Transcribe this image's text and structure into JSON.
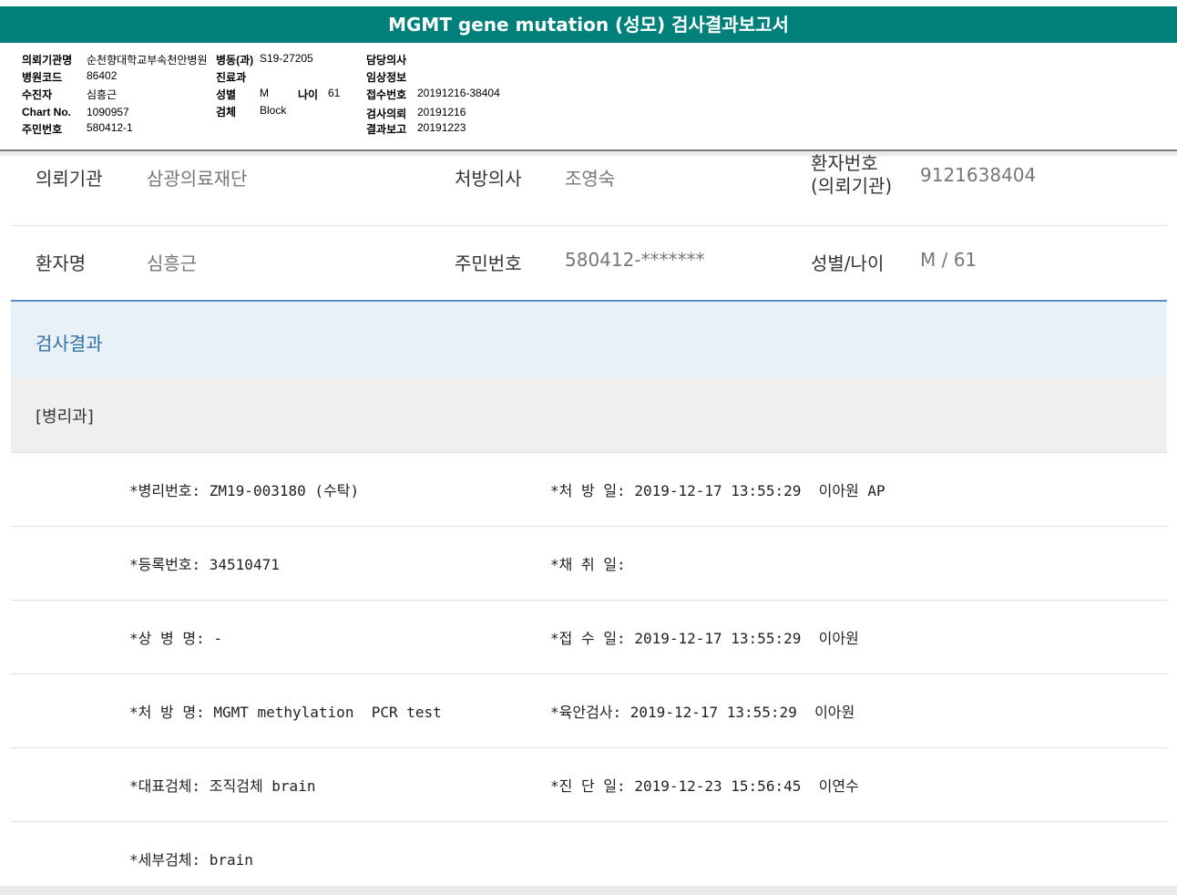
{
  "title": "MGMT gene mutation (성모) 검사결과보고서",
  "header": {
    "inst_label": "의뢰기관명",
    "inst_value": "순천향대학교부속천안병원",
    "ward_label": "병동(과)",
    "ward_value": "S19-27205",
    "doctor_label": "담당의사",
    "code_label": "병원코드",
    "code_value": "86402",
    "dept_label": "진료과",
    "clinical_label": "임상정보",
    "patient_label": "수진자",
    "patient_value": "심흥근",
    "sex_label": "성별",
    "sex_value": "M",
    "age_label": "나이",
    "age_value": "61",
    "receipt_label": "접수번호",
    "receipt_value": "20191216-38404",
    "chart_label": "Chart No.",
    "chart_value": "1090957",
    "specimen_label": "검체",
    "specimen_value": "Block",
    "request_label": "검사의뢰",
    "request_value": "20191216",
    "id_label": "주민번호",
    "id_value": "580412-1",
    "report_label": "결과보고",
    "report_value": "20191223"
  },
  "info": {
    "inst_label": "의뢰기관",
    "inst_value": "삼광의료재단",
    "doctor_label": "처방의사",
    "doctor_value": "조영숙",
    "patno_label_1": "환자번호",
    "patno_label_2": "(의뢰기관)",
    "patno_value": "9121638404",
    "name_label": "환자명",
    "name_value": "심흥근",
    "rrn_label": "주민번호",
    "rrn_value": "580412-*******",
    "sexage_label": "성별/나이",
    "sexage_value": "M / 61"
  },
  "result_title": "검사결과",
  "dept_title": "[병리과]",
  "rows": [
    {
      "left": "*병리번호: ZM19-003180 (수탁)",
      "right": "*처 방 일: 2019-12-17 13:55:29  이아원 AP"
    },
    {
      "left": "*등록번호: 34510471",
      "right": "*채 취 일:"
    },
    {
      "left": "*상 병 명: -",
      "right": "*접 수 일: 2019-12-17 13:55:29  이아원"
    },
    {
      "left": "*처 방 명: MGMT methylation  PCR test",
      "right": "*육안검사: 2019-12-17 13:55:29  이아원"
    },
    {
      "left": "*대표검체: 조직검체 brain",
      "right": "*진 단 일: 2019-12-23 15:56:45  이연수"
    },
    {
      "left": "*세부검체: brain",
      "right": ""
    }
  ]
}
